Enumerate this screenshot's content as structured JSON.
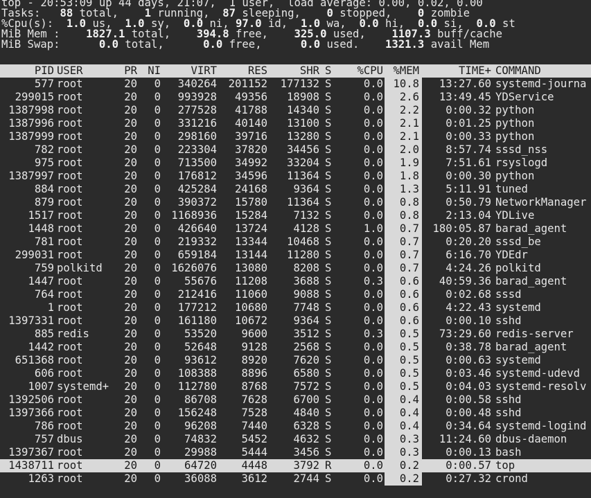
{
  "summary": {
    "uptime": "top - 20:53:09 up 44 days, 21:07,  1 user,  load average: 0.00, 0.02, 0.00",
    "tasks": {
      "label": "Tasks:",
      "total": "88",
      "running": "1",
      "sleeping": "87",
      "stopped": "0",
      "zombie": "0"
    },
    "cpu": {
      "label": "%Cpu(s):",
      "us": "1.0",
      "sy": "1.0",
      "ni": "0.0",
      "id": "97.0",
      "wa": "1.0",
      "hi": "0.0",
      "si": "0.0",
      "st": "0.0"
    },
    "mem": {
      "label": "MiB Mem :",
      "total": "1827.1",
      "free": "394.8",
      "used": "325.0",
      "buff": "1107.3"
    },
    "swap": {
      "label": "MiB Swap:",
      "total": "0.0",
      "free": "0.0",
      "used": "0.0",
      "avail": "1321.3"
    }
  },
  "columns": [
    "PID",
    "USER",
    "PR",
    "NI",
    "VIRT",
    "RES",
    "SHR",
    "S",
    "%CPU",
    "%MEM",
    "TIME+",
    "COMMAND"
  ],
  "highlighted_pid": "1438711",
  "processes": [
    [
      "577",
      "root",
      "20",
      "0",
      "340264",
      "201152",
      "177132",
      "S",
      "0.0",
      "10.8",
      "13:27.60",
      "systemd-journa"
    ],
    [
      "299015",
      "root",
      "20",
      "0",
      "993928",
      "49356",
      "18908",
      "S",
      "0.0",
      "2.6",
      "13:49.45",
      "YDService"
    ],
    [
      "1387998",
      "root",
      "20",
      "0",
      "277528",
      "41788",
      "14340",
      "S",
      "0.0",
      "2.2",
      "0:00.32",
      "python"
    ],
    [
      "1387996",
      "root",
      "20",
      "0",
      "331216",
      "40140",
      "13100",
      "S",
      "0.0",
      "2.1",
      "0:01.25",
      "python"
    ],
    [
      "1387999",
      "root",
      "20",
      "0",
      "298160",
      "39716",
      "13280",
      "S",
      "0.0",
      "2.1",
      "0:00.33",
      "python"
    ],
    [
      "782",
      "root",
      "20",
      "0",
      "223304",
      "37820",
      "34456",
      "S",
      "0.0",
      "2.0",
      "8:57.74",
      "sssd_nss"
    ],
    [
      "975",
      "root",
      "20",
      "0",
      "713500",
      "34992",
      "33204",
      "S",
      "0.0",
      "1.9",
      "7:51.61",
      "rsyslogd"
    ],
    [
      "1387997",
      "root",
      "20",
      "0",
      "176812",
      "34596",
      "11364",
      "S",
      "0.0",
      "1.8",
      "0:00.30",
      "python"
    ],
    [
      "884",
      "root",
      "20",
      "0",
      "425284",
      "24168",
      "9364",
      "S",
      "0.0",
      "1.3",
      "5:11.91",
      "tuned"
    ],
    [
      "879",
      "root",
      "20",
      "0",
      "390372",
      "15780",
      "11364",
      "S",
      "0.0",
      "0.8",
      "0:50.79",
      "NetworkManager"
    ],
    [
      "1517",
      "root",
      "20",
      "0",
      "1168936",
      "15284",
      "7132",
      "S",
      "0.0",
      "0.8",
      "2:13.04",
      "YDLive"
    ],
    [
      "1448",
      "root",
      "20",
      "0",
      "426640",
      "13724",
      "4128",
      "S",
      "1.0",
      "0.7",
      "180:05.87",
      "barad_agent"
    ],
    [
      "781",
      "root",
      "20",
      "0",
      "219332",
      "13344",
      "10468",
      "S",
      "0.0",
      "0.7",
      "0:20.20",
      "sssd_be"
    ],
    [
      "299031",
      "root",
      "20",
      "0",
      "659184",
      "13144",
      "11280",
      "S",
      "0.0",
      "0.7",
      "6:16.70",
      "YDEdr"
    ],
    [
      "759",
      "polkitd",
      "20",
      "0",
      "1626076",
      "13080",
      "8208",
      "S",
      "0.0",
      "0.7",
      "4:24.26",
      "polkitd"
    ],
    [
      "1447",
      "root",
      "20",
      "0",
      "55676",
      "11208",
      "3688",
      "S",
      "0.3",
      "0.6",
      "40:59.36",
      "barad_agent"
    ],
    [
      "764",
      "root",
      "20",
      "0",
      "212416",
      "11060",
      "9088",
      "S",
      "0.0",
      "0.6",
      "0:02.68",
      "sssd"
    ],
    [
      "1",
      "root",
      "20",
      "0",
      "177212",
      "10680",
      "7748",
      "S",
      "0.0",
      "0.6",
      "4:22.43",
      "systemd"
    ],
    [
      "1397331",
      "root",
      "20",
      "0",
      "161180",
      "10672",
      "9364",
      "S",
      "0.0",
      "0.6",
      "0:00.10",
      "sshd"
    ],
    [
      "885",
      "redis",
      "20",
      "0",
      "53520",
      "9600",
      "3512",
      "S",
      "0.3",
      "0.5",
      "73:29.60",
      "redis-server"
    ],
    [
      "1442",
      "root",
      "20",
      "0",
      "52648",
      "9128",
      "2568",
      "S",
      "0.0",
      "0.5",
      "0:38.78",
      "barad_agent"
    ],
    [
      "651368",
      "root",
      "20",
      "0",
      "93612",
      "8920",
      "7620",
      "S",
      "0.0",
      "0.5",
      "0:00.63",
      "systemd"
    ],
    [
      "606",
      "root",
      "20",
      "0",
      "108388",
      "8896",
      "6580",
      "S",
      "0.0",
      "0.5",
      "0:03.46",
      "systemd-udevd"
    ],
    [
      "1007",
      "systemd+",
      "20",
      "0",
      "112780",
      "8768",
      "7572",
      "S",
      "0.0",
      "0.5",
      "0:04.03",
      "systemd-resolv"
    ],
    [
      "1392506",
      "root",
      "20",
      "0",
      "86708",
      "7628",
      "6700",
      "S",
      "0.0",
      "0.4",
      "0:00.58",
      "sshd"
    ],
    [
      "1397366",
      "root",
      "20",
      "0",
      "156248",
      "7528",
      "4840",
      "S",
      "0.0",
      "0.4",
      "0:00.48",
      "sshd"
    ],
    [
      "786",
      "root",
      "20",
      "0",
      "96208",
      "7440",
      "6328",
      "S",
      "0.0",
      "0.4",
      "0:34.64",
      "systemd-logind"
    ],
    [
      "757",
      "dbus",
      "20",
      "0",
      "74832",
      "5452",
      "4632",
      "S",
      "0.0",
      "0.3",
      "11:24.60",
      "dbus-daemon"
    ],
    [
      "1397367",
      "root",
      "20",
      "0",
      "29988",
      "5444",
      "3456",
      "S",
      "0.0",
      "0.3",
      "0:00.13",
      "bash"
    ],
    [
      "1438711",
      "root",
      "20",
      "0",
      "64720",
      "4448",
      "3792",
      "R",
      "0.0",
      "0.2",
      "0:00.57",
      "top"
    ],
    [
      "1263",
      "root",
      "20",
      "0",
      "36088",
      "3612",
      "2744",
      "S",
      "0.0",
      "0.2",
      "0:27.32",
      "crond"
    ]
  ]
}
